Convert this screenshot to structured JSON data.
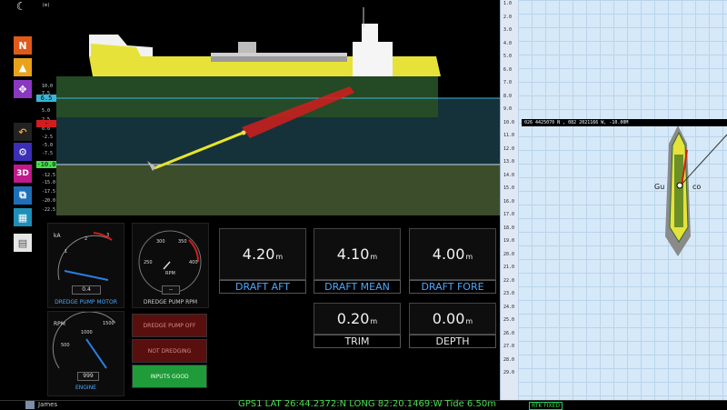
{
  "toolbar": {
    "items": [
      {
        "name": "north-up",
        "glyph": "N",
        "color": "#e05a1a"
      },
      {
        "name": "nav-mode",
        "glyph": "▲",
        "color": "#e9a21a"
      },
      {
        "name": "center-vessel",
        "glyph": "✥",
        "color": "#8a38c2"
      },
      {
        "name": "undo",
        "glyph": "↶",
        "color": "#222222"
      },
      {
        "name": "settings",
        "glyph": "⚙",
        "color": "#3b2fb5"
      },
      {
        "name": "view-3d",
        "glyph": "3D",
        "color": "#c0198c"
      },
      {
        "name": "layers",
        "glyph": "⧉",
        "color": "#1e6fb8"
      },
      {
        "name": "table",
        "glyph": "▦",
        "color": "#1e8fb8"
      },
      {
        "name": "notes",
        "glyph": "▤",
        "color": "#e6e6e6"
      }
    ]
  },
  "sideview": {
    "unit_label": "(m)",
    "scale_marks": [
      "10.0",
      "7.5",
      "5.0",
      "2.5",
      "0.0",
      "-2.5",
      "-5.0",
      "-7.5",
      "-10.0",
      "-12.5",
      "-15.0",
      "-17.5",
      "-20.0",
      "-22.5"
    ],
    "waterline_tag": "6.5",
    "hull_tag": "-",
    "seabed_tag": "-10.0"
  },
  "gauges": {
    "motor": {
      "label": "DREDGE PUMP MOTOR",
      "unit": "kA",
      "value": "0.4",
      "ticks": [
        "0",
        "1",
        "2",
        "3"
      ]
    },
    "rpm": {
      "label": "DREDGE PUMP RPM",
      "unit": "RPM",
      "value": "--",
      "ticks": [
        "250",
        "300",
        "350",
        "400"
      ]
    },
    "engine": {
      "label": "ENGINE",
      "unit": "RPM",
      "value": "999",
      "ticks": [
        "500",
        "1000",
        "1500"
      ]
    }
  },
  "status": {
    "pump_off": "DREDGE PUMP OFF",
    "not_dredging": "NOT DREDGING",
    "inputs_good": "INPUTS GOOD"
  },
  "readouts": {
    "draft_aft": {
      "value": "4.20",
      "unit": "m",
      "label": "DRAFT AFT"
    },
    "draft_mean": {
      "value": "4.10",
      "unit": "m",
      "label": "DRAFT MEAN"
    },
    "draft_fore": {
      "value": "4.00",
      "unit": "m",
      "label": "DRAFT FORE"
    },
    "trim": {
      "value": "0.20",
      "unit": "m",
      "label": "TRIM"
    },
    "depth": {
      "value": "0.00",
      "unit": "m",
      "label": "DEPTH"
    }
  },
  "depth_scale": [
    "1.0",
    "2.0",
    "3.0",
    "4.0",
    "5.0",
    "6.0",
    "7.0",
    "8.0",
    "9.0",
    "10.0",
    "11.0",
    "12.0",
    "13.0",
    "14.0",
    "15.0",
    "16.0",
    "17.0",
    "18.0",
    "19.0",
    "20.0",
    "21.0",
    "22.0",
    "23.0",
    "24.0",
    "25.0",
    "26.0",
    "27.0",
    "28.0",
    "29.0"
  ],
  "map": {
    "coord_readout": "026 4425070 N , 082 2021166 W, -10.00M",
    "vessel_label": "Gu",
    "vessel_label2": "co"
  },
  "bottom": {
    "user": "James",
    "status_line": "GPS1 LAT 26:44.2372:N  LONG 82:20.1469:W        Tide 6.50m",
    "rtk": "RTK FIXED"
  }
}
